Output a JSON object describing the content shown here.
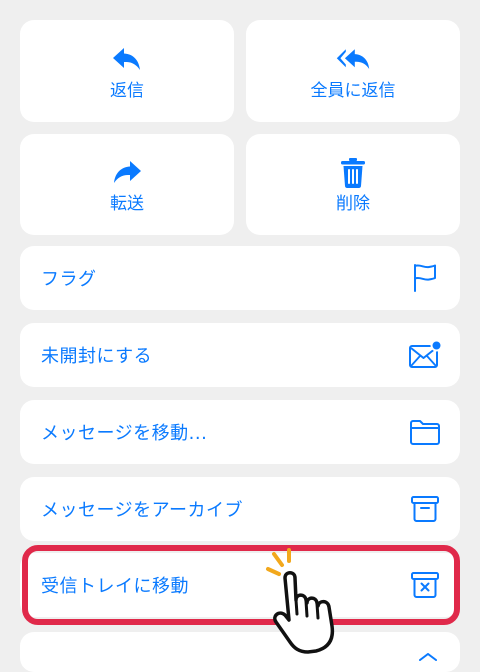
{
  "actions_grid": [
    {
      "label": "返信",
      "icon": "reply-icon"
    },
    {
      "label": "全員に返信",
      "icon": "reply-all-icon"
    },
    {
      "label": "転送",
      "icon": "forward-icon"
    },
    {
      "label": "削除",
      "icon": "trash-icon"
    }
  ],
  "menu": [
    {
      "label": "フラグ",
      "icon": "flag-icon"
    },
    {
      "label": "未開封にする",
      "icon": "mark-unread-icon"
    },
    {
      "label": "メッセージを移動...",
      "icon": "folder-icon"
    },
    {
      "label": "メッセージをアーカイブ",
      "icon": "archive-icon"
    },
    {
      "label": "受信トレイに移動",
      "icon": "unarchive-icon"
    }
  ],
  "colors": {
    "accent": "#0a7aff",
    "highlight": "#e0294a",
    "background": "#efefef",
    "card": "#ffffff"
  }
}
